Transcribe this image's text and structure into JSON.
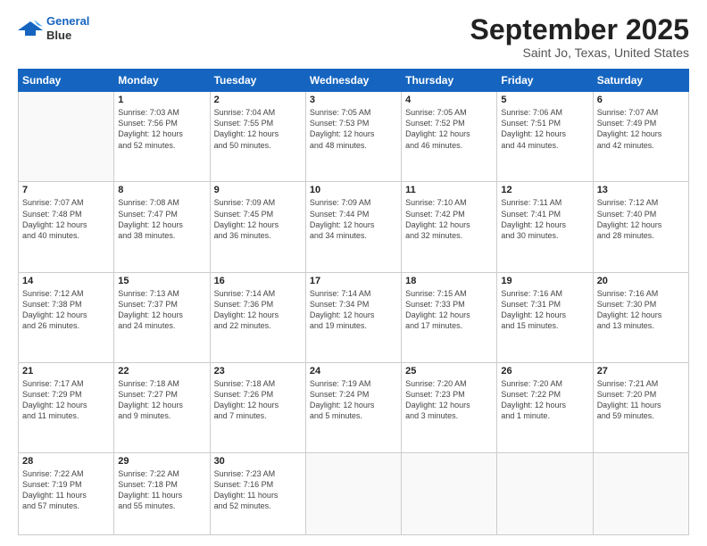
{
  "header": {
    "logo_line1": "General",
    "logo_line2": "Blue",
    "title": "September 2025",
    "subtitle": "Saint Jo, Texas, United States"
  },
  "weekdays": [
    "Sunday",
    "Monday",
    "Tuesday",
    "Wednesday",
    "Thursday",
    "Friday",
    "Saturday"
  ],
  "weeks": [
    [
      {
        "num": "",
        "info": ""
      },
      {
        "num": "1",
        "info": "Sunrise: 7:03 AM\nSunset: 7:56 PM\nDaylight: 12 hours\nand 52 minutes."
      },
      {
        "num": "2",
        "info": "Sunrise: 7:04 AM\nSunset: 7:55 PM\nDaylight: 12 hours\nand 50 minutes."
      },
      {
        "num": "3",
        "info": "Sunrise: 7:05 AM\nSunset: 7:53 PM\nDaylight: 12 hours\nand 48 minutes."
      },
      {
        "num": "4",
        "info": "Sunrise: 7:05 AM\nSunset: 7:52 PM\nDaylight: 12 hours\nand 46 minutes."
      },
      {
        "num": "5",
        "info": "Sunrise: 7:06 AM\nSunset: 7:51 PM\nDaylight: 12 hours\nand 44 minutes."
      },
      {
        "num": "6",
        "info": "Sunrise: 7:07 AM\nSunset: 7:49 PM\nDaylight: 12 hours\nand 42 minutes."
      }
    ],
    [
      {
        "num": "7",
        "info": "Sunrise: 7:07 AM\nSunset: 7:48 PM\nDaylight: 12 hours\nand 40 minutes."
      },
      {
        "num": "8",
        "info": "Sunrise: 7:08 AM\nSunset: 7:47 PM\nDaylight: 12 hours\nand 38 minutes."
      },
      {
        "num": "9",
        "info": "Sunrise: 7:09 AM\nSunset: 7:45 PM\nDaylight: 12 hours\nand 36 minutes."
      },
      {
        "num": "10",
        "info": "Sunrise: 7:09 AM\nSunset: 7:44 PM\nDaylight: 12 hours\nand 34 minutes."
      },
      {
        "num": "11",
        "info": "Sunrise: 7:10 AM\nSunset: 7:42 PM\nDaylight: 12 hours\nand 32 minutes."
      },
      {
        "num": "12",
        "info": "Sunrise: 7:11 AM\nSunset: 7:41 PM\nDaylight: 12 hours\nand 30 minutes."
      },
      {
        "num": "13",
        "info": "Sunrise: 7:12 AM\nSunset: 7:40 PM\nDaylight: 12 hours\nand 28 minutes."
      }
    ],
    [
      {
        "num": "14",
        "info": "Sunrise: 7:12 AM\nSunset: 7:38 PM\nDaylight: 12 hours\nand 26 minutes."
      },
      {
        "num": "15",
        "info": "Sunrise: 7:13 AM\nSunset: 7:37 PM\nDaylight: 12 hours\nand 24 minutes."
      },
      {
        "num": "16",
        "info": "Sunrise: 7:14 AM\nSunset: 7:36 PM\nDaylight: 12 hours\nand 22 minutes."
      },
      {
        "num": "17",
        "info": "Sunrise: 7:14 AM\nSunset: 7:34 PM\nDaylight: 12 hours\nand 19 minutes."
      },
      {
        "num": "18",
        "info": "Sunrise: 7:15 AM\nSunset: 7:33 PM\nDaylight: 12 hours\nand 17 minutes."
      },
      {
        "num": "19",
        "info": "Sunrise: 7:16 AM\nSunset: 7:31 PM\nDaylight: 12 hours\nand 15 minutes."
      },
      {
        "num": "20",
        "info": "Sunrise: 7:16 AM\nSunset: 7:30 PM\nDaylight: 12 hours\nand 13 minutes."
      }
    ],
    [
      {
        "num": "21",
        "info": "Sunrise: 7:17 AM\nSunset: 7:29 PM\nDaylight: 12 hours\nand 11 minutes."
      },
      {
        "num": "22",
        "info": "Sunrise: 7:18 AM\nSunset: 7:27 PM\nDaylight: 12 hours\nand 9 minutes."
      },
      {
        "num": "23",
        "info": "Sunrise: 7:18 AM\nSunset: 7:26 PM\nDaylight: 12 hours\nand 7 minutes."
      },
      {
        "num": "24",
        "info": "Sunrise: 7:19 AM\nSunset: 7:24 PM\nDaylight: 12 hours\nand 5 minutes."
      },
      {
        "num": "25",
        "info": "Sunrise: 7:20 AM\nSunset: 7:23 PM\nDaylight: 12 hours\nand 3 minutes."
      },
      {
        "num": "26",
        "info": "Sunrise: 7:20 AM\nSunset: 7:22 PM\nDaylight: 12 hours\nand 1 minute."
      },
      {
        "num": "27",
        "info": "Sunrise: 7:21 AM\nSunset: 7:20 PM\nDaylight: 11 hours\nand 59 minutes."
      }
    ],
    [
      {
        "num": "28",
        "info": "Sunrise: 7:22 AM\nSunset: 7:19 PM\nDaylight: 11 hours\nand 57 minutes."
      },
      {
        "num": "29",
        "info": "Sunrise: 7:22 AM\nSunset: 7:18 PM\nDaylight: 11 hours\nand 55 minutes."
      },
      {
        "num": "30",
        "info": "Sunrise: 7:23 AM\nSunset: 7:16 PM\nDaylight: 11 hours\nand 52 minutes."
      },
      {
        "num": "",
        "info": ""
      },
      {
        "num": "",
        "info": ""
      },
      {
        "num": "",
        "info": ""
      },
      {
        "num": "",
        "info": ""
      }
    ]
  ]
}
